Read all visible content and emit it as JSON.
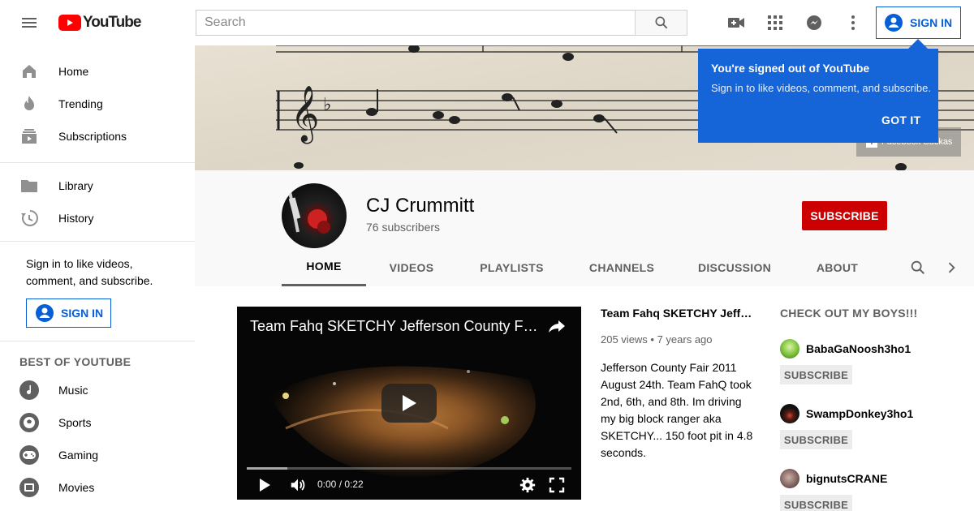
{
  "masthead": {
    "logo_text": "YouTube",
    "search_placeholder": "Search",
    "signin_label": "SIGN IN",
    "icons": [
      "menu-icon",
      "create-video-icon",
      "apps-icon",
      "messages-icon",
      "more-vert-icon"
    ]
  },
  "sidebar": {
    "main_items": [
      {
        "label": "Home",
        "icon": "home-icon"
      },
      {
        "label": "Trending",
        "icon": "trending-icon"
      },
      {
        "label": "Subscriptions",
        "icon": "subscriptions-icon"
      }
    ],
    "library_items": [
      {
        "label": "Library",
        "icon": "library-icon"
      },
      {
        "label": "History",
        "icon": "history-icon"
      }
    ],
    "signin_prompt": "Sign in to like videos, comment, and subscribe.",
    "signin_label": "SIGN IN",
    "best_header": "BEST OF YOUTUBE",
    "best_items": [
      {
        "label": "Music",
        "icon": "music-icon"
      },
      {
        "label": "Sports",
        "icon": "sports-icon"
      },
      {
        "label": "Gaming",
        "icon": "gaming-icon"
      },
      {
        "label": "Movies",
        "icon": "movies-icon"
      }
    ]
  },
  "banner": {
    "facebook_link": "Facebook Suckas"
  },
  "popup": {
    "title": "You're signed out of YouTube",
    "text": "Sign in to like videos, comment, and subscribe.",
    "button": "GOT IT"
  },
  "channel": {
    "name": "CJ Crummitt",
    "subscribers": "76 subscribers",
    "subscribe_label": "SUBSCRIBE",
    "tabs": [
      "HOME",
      "VIDEOS",
      "PLAYLISTS",
      "CHANNELS",
      "DISCUSSION",
      "ABOUT"
    ],
    "active_tab": "HOME"
  },
  "featured_video": {
    "player_title": "Team Fahq SKETCHY Jefferson County Fai...",
    "title": "Team Fahq SKETCHY Jeffer...",
    "meta": "205 views • 7 years ago",
    "description": "Jefferson County Fair 2011 August 24th. Team FahQ took 2nd, 6th, and 8th. Im driving my big block ranger aka SKETCHY... 150 foot pit in 4.8 seconds.",
    "time": "0:00 / 0:22"
  },
  "featured_channels": {
    "header": "CHECK OUT MY BOYS!!!",
    "subscribe_label": "SUBSCRIBE",
    "items": [
      {
        "name": "BabaGaNoosh3ho1",
        "color": "#7bbf3a"
      },
      {
        "name": "SwampDonkey3ho1",
        "color": "#111111"
      },
      {
        "name": "bignutsCRANE",
        "color": "#8a6a66"
      }
    ]
  },
  "colors": {
    "brand_red": "#ff0000",
    "subscribe_red": "#cc0000",
    "link_blue": "#065fd4",
    "popup_blue": "#1565d8"
  }
}
